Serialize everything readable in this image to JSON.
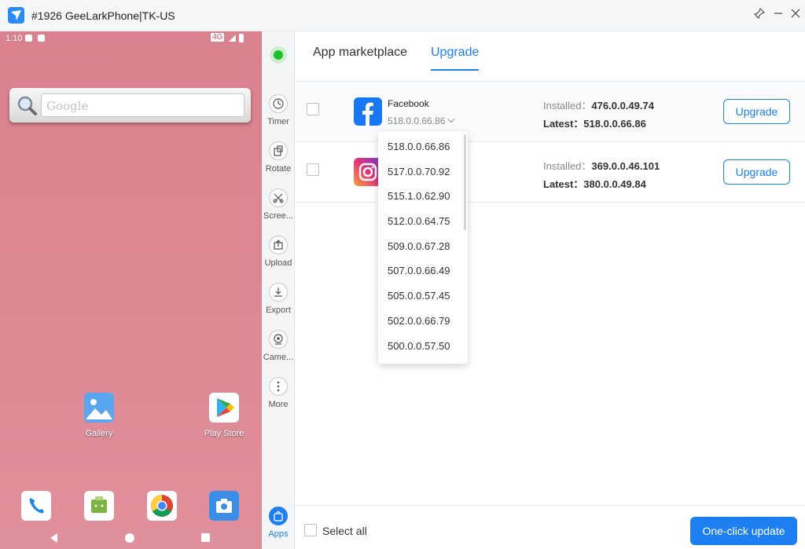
{
  "window": {
    "title": "#1926 GeeLarkPhone|TK-US",
    "icons": [
      "pin-icon",
      "minimize-icon",
      "close-icon"
    ]
  },
  "phone": {
    "status_time": "1:10",
    "network": "4G",
    "search_placeholder": "Google",
    "home_apps": [
      {
        "label": "Gallery",
        "icon": "gallery-icon"
      },
      {
        "label": "Play Store",
        "icon": "play-store-icon"
      }
    ],
    "dock": [
      "phone-icon",
      "messaging-icon",
      "chrome-icon",
      "camera-icon"
    ]
  },
  "tools": [
    {
      "label": "Timer",
      "icon": "clock-icon"
    },
    {
      "label": "Rotate",
      "icon": "rotate-icon"
    },
    {
      "label": "Scree...",
      "icon": "screenshot-icon"
    },
    {
      "label": "Upload",
      "icon": "upload-icon"
    },
    {
      "label": "Export",
      "icon": "export-icon"
    },
    {
      "label": "Came...",
      "icon": "camera-icon"
    },
    {
      "label": "More",
      "icon": "more-icon"
    },
    {
      "label": "Apps",
      "icon": "apps-icon"
    }
  ],
  "tabs": [
    "App marketplace",
    "Upgrade"
  ],
  "active_tab": "Upgrade",
  "apps": [
    {
      "name": "Facebook",
      "selected_version": "518.0.0.66.86",
      "installed_label": "Installed：",
      "installed": "476.0.0.49.74",
      "latest_label": "Latest：",
      "latest": "518.0.0.66.86",
      "button": "Upgrade"
    },
    {
      "name": "Instagram",
      "installed_label": "Installed：",
      "installed": "369.0.0.46.101",
      "latest_label": "Latest：",
      "latest": "380.0.0.49.84",
      "button": "Upgrade"
    }
  ],
  "version_options": [
    "518.0.0.66.86",
    "517.0.0.70.92",
    "515.1.0.62.90",
    "512.0.0.64.75",
    "509.0.0.67.28",
    "507.0.0.66.49",
    "505.0.0.57.45",
    "502.0.0.66.79",
    "500.0.0.57.50"
  ],
  "footer": {
    "select_all": "Select all",
    "one_click": "One-click update"
  },
  "colors": {
    "accent": "#1e7ff0",
    "online": "#1fbf2c",
    "phone_wallpaper": "#dc8794"
  }
}
